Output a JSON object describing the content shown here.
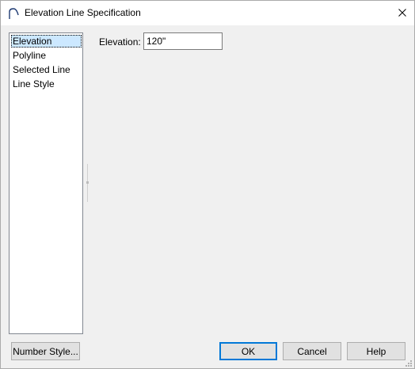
{
  "window": {
    "title": "Elevation Line Specification",
    "app_icon": "arc-icon",
    "close_icon": "close-icon"
  },
  "sidebar": {
    "items": [
      {
        "label": "Elevation",
        "selected": true
      },
      {
        "label": "Polyline",
        "selected": false
      },
      {
        "label": "Selected Line",
        "selected": false
      },
      {
        "label": "Line Style",
        "selected": false
      }
    ]
  },
  "panel": {
    "elevation_label": "Elevation:",
    "elevation_value": "120\""
  },
  "footer": {
    "number_style_label": "Number Style...",
    "ok_label": "OK",
    "cancel_label": "Cancel",
    "help_label": "Help"
  },
  "colors": {
    "selection": "#cce8ff",
    "default_button_border": "#0078d7",
    "button_face": "#e1e1e1",
    "dialog_background": "#f0f0f0"
  }
}
